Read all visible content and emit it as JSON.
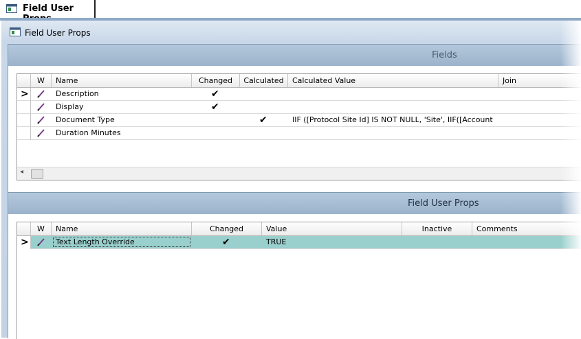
{
  "tab": {
    "title": "Field User Props"
  },
  "window": {
    "title": "Field User Props"
  },
  "fields_panel": {
    "title": "Fields",
    "columns": {
      "w": "W",
      "name": "Name",
      "changed": "Changed",
      "calculated": "Calculated",
      "calculated_value": "Calculated Value",
      "join": "Join"
    },
    "rows": [
      {
        "name": "Description",
        "changed": "✔",
        "calculated": "",
        "calculated_value": ""
      },
      {
        "name": "Display",
        "changed": "✔",
        "calculated": "",
        "calculated_value": ""
      },
      {
        "name": "Document Type",
        "changed": "",
        "calculated": "✔",
        "calculated_value": "IIF ([Protocol Site Id] IS NOT NULL, 'Site', IIF([Account ]"
      },
      {
        "name": "Duration Minutes",
        "changed": "",
        "calculated": "",
        "calculated_value": ""
      }
    ],
    "scroll_left_glyph": "◂"
  },
  "props_panel": {
    "title": "Field User Props",
    "columns": {
      "w": "W",
      "name": "Name",
      "changed": "Changed",
      "value": "Value",
      "inactive": "Inactive",
      "comments": "Comments"
    },
    "rows": [
      {
        "name": "Text Length Override",
        "changed": "✔",
        "value": "TRUE",
        "inactive": "",
        "comments": ""
      }
    ]
  },
  "icons": {
    "window": "window-icon",
    "pencil": "pencil-icon",
    "row_indicator": "chevron-right-icon"
  },
  "colors": {
    "selected_row": "#99cfcc",
    "panel_header": "#a7bdd3",
    "window_bg": "#c9d8e9"
  }
}
